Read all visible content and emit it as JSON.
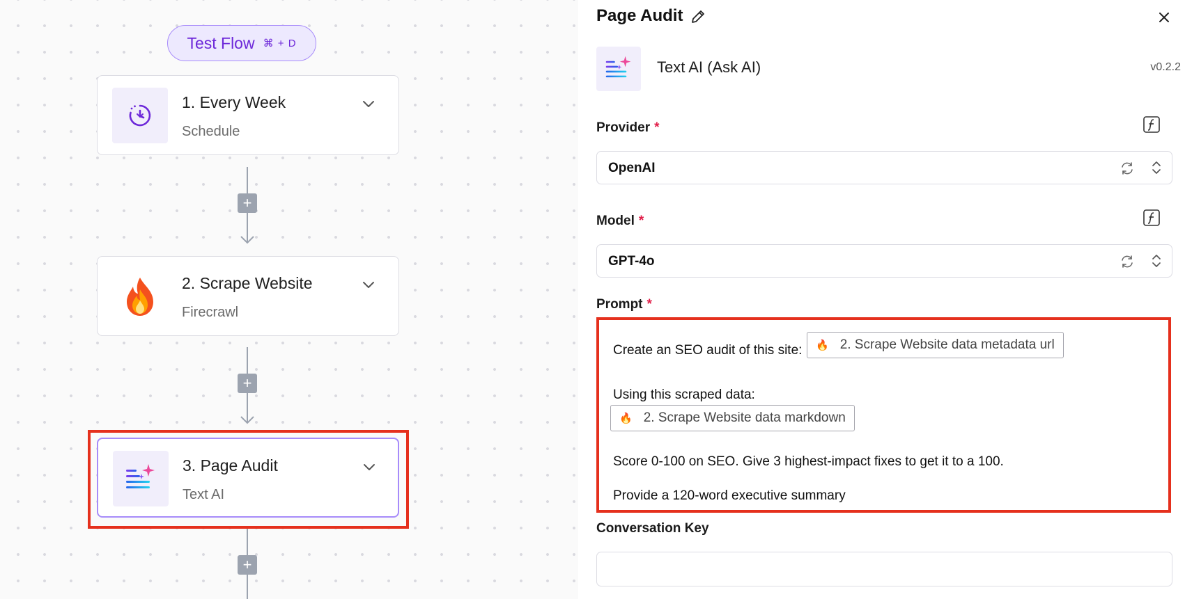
{
  "canvas": {
    "test_flow": {
      "label": "Test Flow",
      "shortcut": "⌘ + D"
    },
    "nodes": [
      {
        "title": "1. Every Week",
        "subtitle": "Schedule",
        "icon": "schedule-clock-icon"
      },
      {
        "title": "2. Scrape Website",
        "subtitle": "Firecrawl",
        "icon": "fire-icon"
      },
      {
        "title": "3. Page Audit",
        "subtitle": "Text AI",
        "icon": "text-ai-sparkle-icon",
        "selected": true
      }
    ],
    "add_step_label": "+"
  },
  "panel": {
    "title": "Page Audit",
    "piece_name": "Text AI (Ask AI)",
    "version": "v0.2.2",
    "provider": {
      "label": "Provider",
      "required_mark": "*",
      "value": "OpenAI"
    },
    "model": {
      "label": "Model",
      "required_mark": "*",
      "value": "GPT-4o"
    },
    "prompt": {
      "label": "Prompt",
      "required_mark": "*",
      "line1": "Create an SEO audit of this site:",
      "token1": "2. Scrape Website data metadata url",
      "line2": "Using this scraped data:",
      "token2": "2. Scrape Website data markdown",
      "line3": "Score 0-100 on SEO. Give 3 highest-impact fixes to get it to a 100.",
      "line4": "Provide a 120-word executive summary"
    },
    "conversation_key": {
      "label": "Conversation Key",
      "value": ""
    },
    "token_flame": "🔥"
  },
  "colors": {
    "accent": "#6d28d9",
    "accent_light": "#ede9fe",
    "highlight": "#e5301d",
    "required": "#e11d48"
  }
}
